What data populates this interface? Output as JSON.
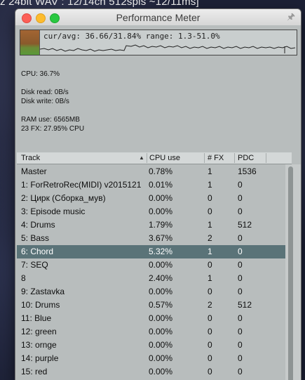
{
  "background": {
    "title_text": "z 24bit WAV : 12/14ch 512spls ~12/11ms]"
  },
  "window": {
    "title": "Performance Meter",
    "pin_icon": "pin-icon"
  },
  "meter": {
    "summary": "cur/avg: 36.66/31.84%  range: 1.3-51.0%",
    "bar_color_top": "#a36533",
    "bar_color_bottom": "#5a9a3a"
  },
  "stats": {
    "cpu": "CPU: 36.7%",
    "disk_read": "Disk read: 0B/s",
    "disk_write": "Disk write: 0B/s",
    "ram": "RAM use: 6565MB",
    "fx": "23 FX: 27.95% CPU"
  },
  "table": {
    "headers": {
      "track": "Track",
      "cpu": "CPU use",
      "fx": "# FX",
      "pdc": "PDC"
    },
    "selected_color": "#5a7378",
    "rows": [
      {
        "name": "Master",
        "cpu": "0.78%",
        "fx": "1",
        "pdc": "1536"
      },
      {
        "name": "1: ForRetroRec(MIDI) v2015121",
        "cpu": "0.01%",
        "fx": "1",
        "pdc": "0"
      },
      {
        "name": "2: Цирк (Сборка_мув)",
        "cpu": "0.00%",
        "fx": "0",
        "pdc": "0"
      },
      {
        "name": "3: Episode music",
        "cpu": "0.00%",
        "fx": "0",
        "pdc": "0"
      },
      {
        "name": "4: Drums",
        "cpu": "1.79%",
        "fx": "1",
        "pdc": "512"
      },
      {
        "name": "5: Bass",
        "cpu": "3.67%",
        "fx": "2",
        "pdc": "0"
      },
      {
        "name": "6: Chord",
        "cpu": "5.32%",
        "fx": "1",
        "pdc": "0"
      },
      {
        "name": "7: SEQ",
        "cpu": "0.00%",
        "fx": "0",
        "pdc": "0"
      },
      {
        "name": "8",
        "cpu": "2.40%",
        "fx": "1",
        "pdc": "0"
      },
      {
        "name": "9: Zastavka",
        "cpu": "0.00%",
        "fx": "0",
        "pdc": "0"
      },
      {
        "name": "10: Drums",
        "cpu": "0.57%",
        "fx": "2",
        "pdc": "512"
      },
      {
        "name": "11: Blue",
        "cpu": "0.00%",
        "fx": "0",
        "pdc": "0"
      },
      {
        "name": "12: green",
        "cpu": "0.00%",
        "fx": "0",
        "pdc": "0"
      },
      {
        "name": "13: ornge",
        "cpu": "0.00%",
        "fx": "0",
        "pdc": "0"
      },
      {
        "name": "14: purple",
        "cpu": "0.00%",
        "fx": "0",
        "pdc": "0"
      },
      {
        "name": "15: red",
        "cpu": "0.00%",
        "fx": "0",
        "pdc": "0"
      }
    ],
    "selected_row": 6
  }
}
